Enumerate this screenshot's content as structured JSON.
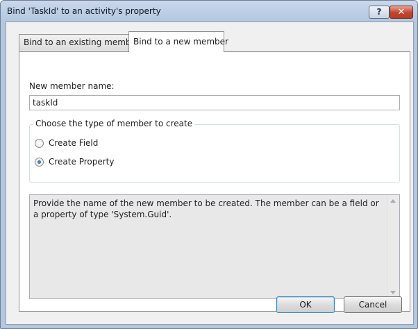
{
  "window": {
    "title": "Bind 'TaskId' to an activity's property",
    "help_glyph": "?",
    "close_glyph": "✕"
  },
  "tabs": [
    {
      "label": "Bind to an existing member",
      "selected": false
    },
    {
      "label": "Bind to a new member",
      "selected": true
    }
  ],
  "form": {
    "name_label": "New member name:",
    "name_value": "taskId",
    "group_title": "Choose the type of member to create",
    "options": [
      {
        "label": "Create Field",
        "checked": false
      },
      {
        "label": "Create Property",
        "checked": true
      }
    ],
    "description": "Provide the name of the new member to be created. The member can be a field or a property of type 'System.Guid'."
  },
  "buttons": {
    "ok": "OK",
    "cancel": "Cancel"
  },
  "colors": {
    "title_bar": "#b3c7df",
    "close_button": "#c2442e",
    "default_button_border": "#3c7fb1"
  }
}
